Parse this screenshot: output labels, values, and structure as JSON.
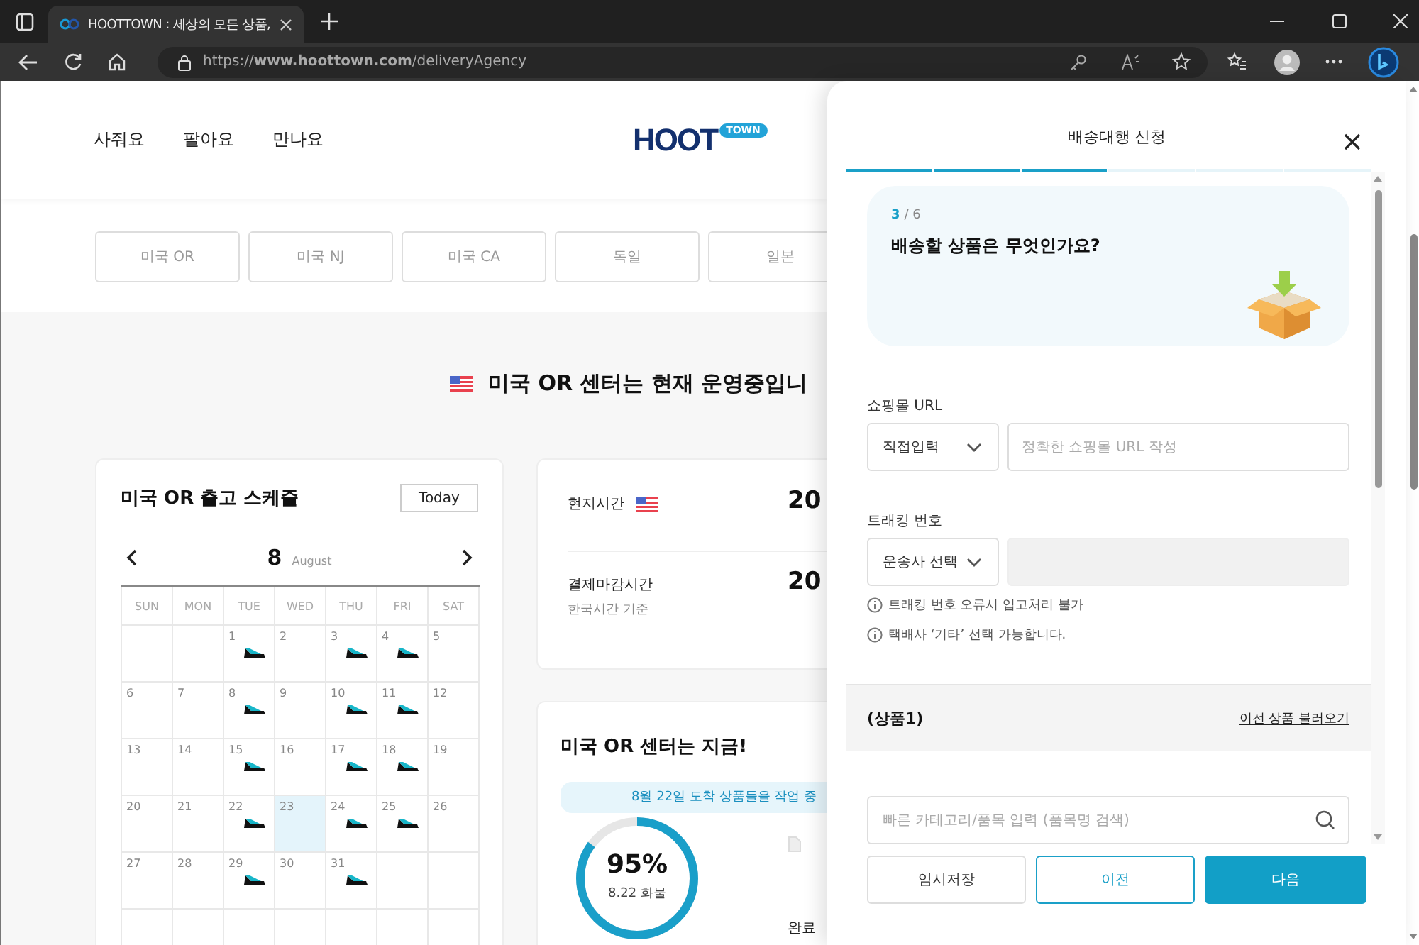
{
  "browser": {
    "tab_title": "HOOTTOWN : 세상의 모든 상품,",
    "url": "https://**www.hoottown.com**/deliveryAgency"
  },
  "header": {
    "nav": [
      "사줘요",
      "팔아요",
      "만나요"
    ],
    "logo": {
      "main": "HOOT",
      "badge": "TOWN"
    }
  },
  "country_tabs": [
    "미국 OR",
    "미국 NJ",
    "미국 CA",
    "독일",
    "일본"
  ],
  "status_title": "미국 OR 센터는 현재 운영중입니",
  "schedule": {
    "title": "미국 OR 출고 스케줄",
    "today_button": "Today",
    "month_number": "8",
    "month_name": "August",
    "weekdays": [
      "SUN",
      "MON",
      "TUE",
      "WED",
      "THU",
      "FRI",
      "SAT"
    ],
    "weeks": [
      [
        {
          "kind": "blank"
        },
        {
          "kind": "blank"
        },
        {
          "kind": "day",
          "day": "1",
          "shipping": true,
          "selected": false
        },
        {
          "kind": "day",
          "day": "2",
          "shipping": false,
          "selected": false
        },
        {
          "kind": "day",
          "day": "3",
          "shipping": true,
          "selected": false
        },
        {
          "kind": "day",
          "day": "4",
          "shipping": true,
          "selected": false
        },
        {
          "kind": "day",
          "day": "5",
          "shipping": false,
          "selected": false
        }
      ],
      [
        {
          "kind": "day",
          "day": "6",
          "shipping": false,
          "selected": false
        },
        {
          "kind": "day",
          "day": "7",
          "shipping": false,
          "selected": false
        },
        {
          "kind": "day",
          "day": "8",
          "shipping": true,
          "selected": false
        },
        {
          "kind": "day",
          "day": "9",
          "shipping": false,
          "selected": false
        },
        {
          "kind": "day",
          "day": "10",
          "shipping": true,
          "selected": false
        },
        {
          "kind": "day",
          "day": "11",
          "shipping": true,
          "selected": false
        },
        {
          "kind": "day",
          "day": "12",
          "shipping": false,
          "selected": false
        }
      ],
      [
        {
          "kind": "day",
          "day": "13",
          "shipping": false,
          "selected": false
        },
        {
          "kind": "day",
          "day": "14",
          "shipping": false,
          "selected": false
        },
        {
          "kind": "day",
          "day": "15",
          "shipping": true,
          "selected": false
        },
        {
          "kind": "day",
          "day": "16",
          "shipping": false,
          "selected": false
        },
        {
          "kind": "day",
          "day": "17",
          "shipping": true,
          "selected": false
        },
        {
          "kind": "day",
          "day": "18",
          "shipping": true,
          "selected": false
        },
        {
          "kind": "day",
          "day": "19",
          "shipping": false,
          "selected": false
        }
      ],
      [
        {
          "kind": "day",
          "day": "20",
          "shipping": false,
          "selected": false
        },
        {
          "kind": "day",
          "day": "21",
          "shipping": false,
          "selected": false
        },
        {
          "kind": "day",
          "day": "22",
          "shipping": true,
          "selected": false
        },
        {
          "kind": "day",
          "day": "23",
          "shipping": false,
          "selected": true
        },
        {
          "kind": "day",
          "day": "24",
          "shipping": true,
          "selected": false
        },
        {
          "kind": "day",
          "day": "25",
          "shipping": true,
          "selected": false
        },
        {
          "kind": "day",
          "day": "26",
          "shipping": false,
          "selected": false
        }
      ],
      [
        {
          "kind": "day",
          "day": "27",
          "shipping": false,
          "selected": false
        },
        {
          "kind": "day",
          "day": "28",
          "shipping": false,
          "selected": false
        },
        {
          "kind": "day",
          "day": "29",
          "shipping": true,
          "selected": false
        },
        {
          "kind": "day",
          "day": "30",
          "shipping": false,
          "selected": false
        },
        {
          "kind": "day",
          "day": "31",
          "shipping": true,
          "selected": false
        },
        {
          "kind": "blank"
        },
        {
          "kind": "blank"
        }
      ],
      [
        {
          "kind": "blank"
        },
        {
          "kind": "blank"
        },
        {
          "kind": "blank"
        },
        {
          "kind": "blank"
        },
        {
          "kind": "blank"
        },
        {
          "kind": "blank"
        },
        {
          "kind": "blank"
        }
      ]
    ]
  },
  "times": [
    {
      "label": "현지시간",
      "flag": true,
      "value": "20"
    },
    {
      "label": "결제마감시간",
      "note": "한국시간 기준",
      "value": "20"
    }
  ],
  "center_now": {
    "title": "미국 OR 센터는 지금!",
    "banner": "8월 22일 도착 상품들을 작업 중",
    "percent": "95%",
    "caption": "8.22 화물",
    "level": 0.85,
    "side_label": "완료"
  },
  "panel": {
    "title": "배송대행 신청",
    "steps": [
      {
        "done": true
      },
      {
        "done": true
      },
      {
        "done": true
      },
      {
        "done": false
      },
      {
        "done": false
      },
      {
        "done": false
      }
    ],
    "step_current": "3",
    "step_total": "/ 6",
    "question": "배송할 상품은 무엇인가요?",
    "fields": [
      {
        "label": "쇼핑몰 URL",
        "select": "직접입력",
        "placeholder": "정확한 쇼핑몰 URL 작성",
        "disabled": false
      },
      {
        "label": "트래킹 번호",
        "select": "운송사 선택",
        "disabled": true
      }
    ],
    "notes": [
      "트래킹 번호 오류시 입고처리 불가",
      "택배사 ‘기타’ 선택 가능합니다."
    ],
    "section_title": "(상품1)",
    "section_link": "이전 상품 불러오기",
    "search_placeholder": "빠른 카테고리/품목 입력 (품목명 검색)",
    "buttons": [
      {
        "label": "임시저장",
        "kind": "plain"
      },
      {
        "label": "이전",
        "kind": "outline"
      },
      {
        "label": "다음",
        "kind": "primary"
      }
    ]
  }
}
